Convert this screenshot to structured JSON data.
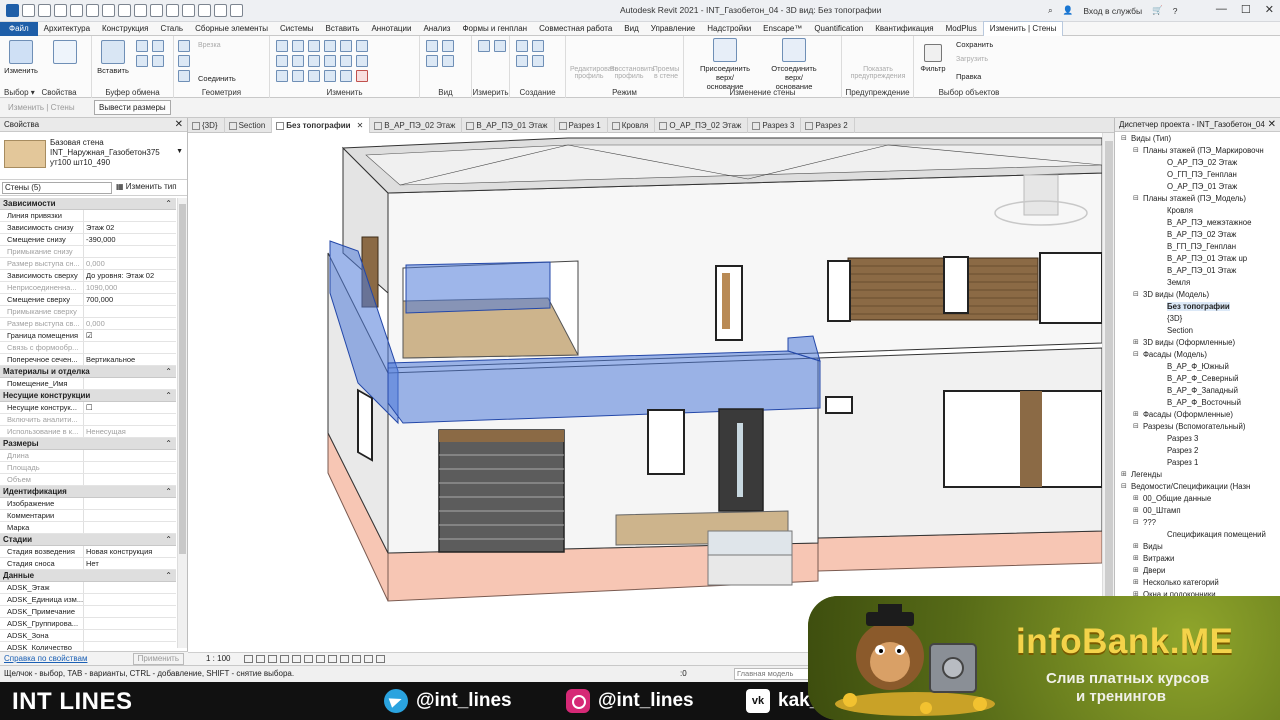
{
  "window": {
    "title": "Autodesk Revit 2021 - INT_Газобетон_04 - 3D вид: Без топографии",
    "signin": "Вход в службы"
  },
  "ribbon_tabs": [
    {
      "label": "Файл",
      "kind": "file"
    },
    {
      "label": "Архитектура"
    },
    {
      "label": "Конструкция"
    },
    {
      "label": "Сталь"
    },
    {
      "label": "Сборные элементы"
    },
    {
      "label": "Системы"
    },
    {
      "label": "Вставить"
    },
    {
      "label": "Аннотации"
    },
    {
      "label": "Анализ"
    },
    {
      "label": "Формы и генплан"
    },
    {
      "label": "Совместная работа"
    },
    {
      "label": "Вид"
    },
    {
      "label": "Управление"
    },
    {
      "label": "Надстройки"
    },
    {
      "label": "Enscape™"
    },
    {
      "label": "Quantification"
    },
    {
      "label": "Квантификация"
    },
    {
      "label": "ModPlus"
    },
    {
      "label": "Изменить | Стены",
      "kind": "active"
    }
  ],
  "ribbon": {
    "modify_label": "Изменить",
    "select_label": "Выбор ▾",
    "properties_label": "Свойства",
    "paste_label": "Вставить",
    "clipboard_label": "Буфер обмена",
    "cut_label": "Врезка",
    "join_label": "Соединить",
    "geometry_label": "Геометрия",
    "modify_group_label": "Изменить",
    "view_label": "Вид",
    "measure_label": "Измерить",
    "create_label": "Создание",
    "edit_profile": "Редактировать профиль",
    "reset_profile": "Восстановить профиль",
    "openings": "Проемы в стене",
    "mode_label": "Режим",
    "attach": "Присоединить верх/основание",
    "detach": "Отсоединить верх/основание",
    "change_wall_label": "Изменение стены",
    "show_warnings": "Показать предупреждения",
    "warning_label": "Предупреждение",
    "filter": "Фильтр",
    "save": "Сохранить",
    "load": "Загрузить",
    "edit_sel": "Правка",
    "selection_label": "Выбор объектов"
  },
  "options_bar": {
    "context": "Изменить | Стены",
    "button": "Вывести размеры"
  },
  "properties": {
    "title": "Свойства",
    "type_family": "Базовая стена",
    "type_name": "INT_Наружная_Газобетон375",
    "type_name2": "ут100 шт10_490",
    "filter": "Стены (5)",
    "edit_type": "Изменить тип",
    "groups": [
      {
        "name": "Зависимости",
        "rows": [
          {
            "k": "Линия привязки",
            "v": ""
          },
          {
            "k": "Зависимость снизу",
            "v": "Этаж 02"
          },
          {
            "k": "Смещение снизу",
            "v": "-390,000"
          },
          {
            "k": "Примыкание снизу",
            "v": "",
            "dis": true
          },
          {
            "k": "Размер выступа сн...",
            "v": "0,000",
            "dis": true
          },
          {
            "k": "Зависимость сверху",
            "v": "До уровня: Этаж 02"
          },
          {
            "k": "Неприсоединенна...",
            "v": "1090,000",
            "dis": true
          },
          {
            "k": "Смещение сверху",
            "v": "700,000"
          },
          {
            "k": "Примыкание сверху",
            "v": "",
            "dis": true
          },
          {
            "k": "Размер выступа св...",
            "v": "0,000",
            "dis": true
          },
          {
            "k": "Граница помещения",
            "v": "☑"
          },
          {
            "k": "Связь с формообр...",
            "v": "",
            "dis": true
          },
          {
            "k": "Поперечное сечен...",
            "v": "Вертикальное"
          }
        ]
      },
      {
        "name": "Материалы и отделка",
        "rows": [
          {
            "k": "Помещение_Имя",
            "v": ""
          }
        ]
      },
      {
        "name": "Несущие конструкции",
        "rows": [
          {
            "k": "Несущие конструк...",
            "v": "☐"
          },
          {
            "k": "Включить аналити...",
            "v": "",
            "dis": true
          },
          {
            "k": "Использование в к...",
            "v": "Ненесущая",
            "dis": true
          }
        ]
      },
      {
        "name": "Размеры",
        "rows": [
          {
            "k": "Длина",
            "v": "",
            "dis": true
          },
          {
            "k": "Площадь",
            "v": "",
            "dis": true
          },
          {
            "k": "Объем",
            "v": "",
            "dis": true
          }
        ]
      },
      {
        "name": "Идентификация",
        "rows": [
          {
            "k": "Изображение",
            "v": ""
          },
          {
            "k": "Комментарии",
            "v": ""
          },
          {
            "k": "Марка",
            "v": ""
          }
        ]
      },
      {
        "name": "Стадии",
        "rows": [
          {
            "k": "Стадия возведения",
            "v": "Новая конструкция"
          },
          {
            "k": "Стадия сноса",
            "v": "Нет"
          }
        ]
      },
      {
        "name": "Данные",
        "rows": [
          {
            "k": "ADSK_Этаж",
            "v": ""
          },
          {
            "k": "ADSK_Единица изм...",
            "v": ""
          },
          {
            "k": "ADSK_Примечание",
            "v": ""
          },
          {
            "k": "ADSK_Группирова...",
            "v": ""
          },
          {
            "k": "ADSK_Зона",
            "v": ""
          },
          {
            "k": "ADSK_Количество",
            "v": ""
          }
        ]
      }
    ],
    "help_link": "Справка по свойствам",
    "apply": "Применить"
  },
  "view_tabs": [
    {
      "label": "{3D}"
    },
    {
      "label": "Section"
    },
    {
      "label": "Без топографии",
      "active": true
    },
    {
      "label": "В_АР_ПЭ_02 Этаж"
    },
    {
      "label": "В_АР_ПЭ_01 Этаж"
    },
    {
      "label": "Разрез 1"
    },
    {
      "label": "Кровля"
    },
    {
      "label": "О_АР_ПЭ_02 Этаж"
    },
    {
      "label": "Разрез 3"
    },
    {
      "label": "Разрез 2"
    }
  ],
  "view_control": {
    "scale": "1 : 100"
  },
  "browser": {
    "title": "Диспетчер проекта - INT_Газобетон_04",
    "nodes": [
      {
        "label": "Виды (Тип)",
        "lvl": 0,
        "tg": "⊟"
      },
      {
        "label": "Планы этажей (ПЭ_Маркировочн",
        "lvl": 1,
        "tg": "⊟"
      },
      {
        "label": "О_АР_ПЭ_02 Этаж",
        "lvl": 2
      },
      {
        "label": "О_ГП_ПЭ_Генплан",
        "lvl": 2
      },
      {
        "label": "О_АР_ПЭ_01 Этаж",
        "lvl": 2
      },
      {
        "label": "Планы этажей (ПЭ_Модель)",
        "lvl": 1,
        "tg": "⊟"
      },
      {
        "label": "Кровля",
        "lvl": 2
      },
      {
        "label": "В_АР_ПЭ_межэтажное",
        "lvl": 2
      },
      {
        "label": "В_АР_ПЭ_02 Этаж",
        "lvl": 2
      },
      {
        "label": "В_ГП_ПЭ_Генплан",
        "lvl": 2
      },
      {
        "label": "В_АР_ПЭ_01 Этаж up",
        "lvl": 2
      },
      {
        "label": "В_АР_ПЭ_01 Этаж",
        "lvl": 2
      },
      {
        "label": "Земля",
        "lvl": 2
      },
      {
        "label": "3D виды (Модель)",
        "lvl": 1,
        "tg": "⊟"
      },
      {
        "label": "Без топографии",
        "lvl": 2,
        "sel": true
      },
      {
        "label": "{3D}",
        "lvl": 2
      },
      {
        "label": "Section",
        "lvl": 2
      },
      {
        "label": "3D виды (Оформленные)",
        "lvl": 1,
        "tg": "⊞"
      },
      {
        "label": "Фасады (Модель)",
        "lvl": 1,
        "tg": "⊟"
      },
      {
        "label": "В_АР_Ф_Южный",
        "lvl": 2
      },
      {
        "label": "В_АР_Ф_Северный",
        "lvl": 2
      },
      {
        "label": "В_АР_Ф_Западный",
        "lvl": 2
      },
      {
        "label": "В_АР_Ф_Восточный",
        "lvl": 2
      },
      {
        "label": "Фасады (Оформленные)",
        "lvl": 1,
        "tg": "⊞"
      },
      {
        "label": "Разрезы (Вспомогательный)",
        "lvl": 1,
        "tg": "⊟"
      },
      {
        "label": "Разрез 3",
        "lvl": 2
      },
      {
        "label": "Разрез 2",
        "lvl": 2
      },
      {
        "label": "Разрез 1",
        "lvl": 2
      },
      {
        "label": "Легенды",
        "lvl": 0,
        "tg": "⊞"
      },
      {
        "label": "Ведомости/Спецификации (Назн",
        "lvl": 0,
        "tg": "⊟"
      },
      {
        "label": "00_Общие данные",
        "lvl": 1,
        "tg": "⊞"
      },
      {
        "label": "00_Штамп",
        "lvl": 1,
        "tg": "⊞"
      },
      {
        "label": "???",
        "lvl": 1,
        "tg": "⊟"
      },
      {
        "label": "Спецификация помещений",
        "lvl": 2
      },
      {
        "label": "Виды",
        "lvl": 1,
        "tg": "⊞"
      },
      {
        "label": "Витражи",
        "lvl": 1,
        "tg": "⊞"
      },
      {
        "label": "Двери",
        "lvl": 1,
        "tg": "⊞"
      },
      {
        "label": "Несколько категорий",
        "lvl": 1,
        "tg": "⊞"
      },
      {
        "label": "Окна и подоконники",
        "lvl": 1,
        "tg": "⊞"
      }
    ]
  },
  "status": {
    "hint": "Щелчок - выбор, TAB - варианты, CTRL - добавление, SHIFT - снятие выбора.",
    "zero": ":0",
    "model": "Главная модель"
  },
  "branding": {
    "name": "INT LINES",
    "telegram": "@int_lines",
    "instagram": "@int_lines",
    "vk": "kak_",
    "vk_icon": "vk"
  },
  "banner": {
    "name": "infoBank.ME",
    "slogan1": "Слив платных курсов",
    "slogan2": "и тренингов"
  },
  "colors": {
    "selection": "#4f7ad9",
    "revit_blue": "#1e5ea8",
    "wood": "#8b6a45",
    "plinth": "#f7c6b4"
  }
}
